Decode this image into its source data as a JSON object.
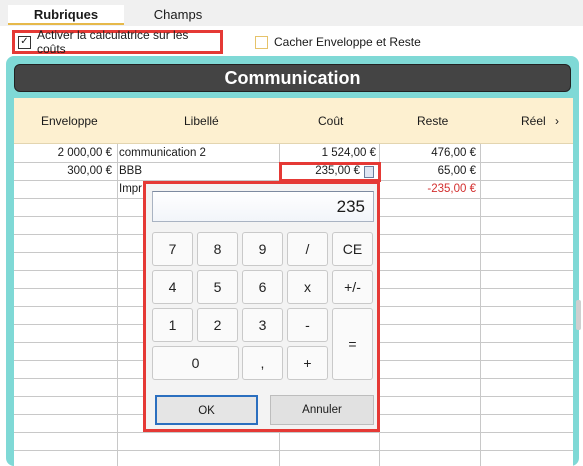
{
  "tabs": {
    "active": "Rubriques",
    "inactive": "Champs"
  },
  "options": {
    "calculator": {
      "label": "Activer la calculatrice sur les coûts",
      "checked": "✓"
    },
    "hide": {
      "label": "Cacher Enveloppe et Reste"
    }
  },
  "section_title": "Communication",
  "columns": [
    "Enveloppe",
    "Libellé",
    "Coût",
    "Reste",
    "Réel"
  ],
  "rows": [
    {
      "enveloppe": "2 000,00 €",
      "libelle": "communication 2",
      "cout": "1 524,00 €",
      "reste": "476,00 €"
    },
    {
      "enveloppe": "300,00 €",
      "libelle": "BBB",
      "cout": "235,00 €",
      "reste": "65,00 €"
    },
    {
      "enveloppe": "",
      "libelle": "Impr",
      "cout": "",
      "reste": "-235,00 €"
    }
  ],
  "calculator": {
    "display": "235",
    "keys": [
      "7",
      "8",
      "9",
      "/",
      "CE",
      "4",
      "5",
      "6",
      "x",
      "+/-",
      "1",
      "2",
      "3",
      "-",
      "=",
      "0",
      ",",
      "+"
    ],
    "ok": "OK",
    "cancel": "Annuler"
  }
}
